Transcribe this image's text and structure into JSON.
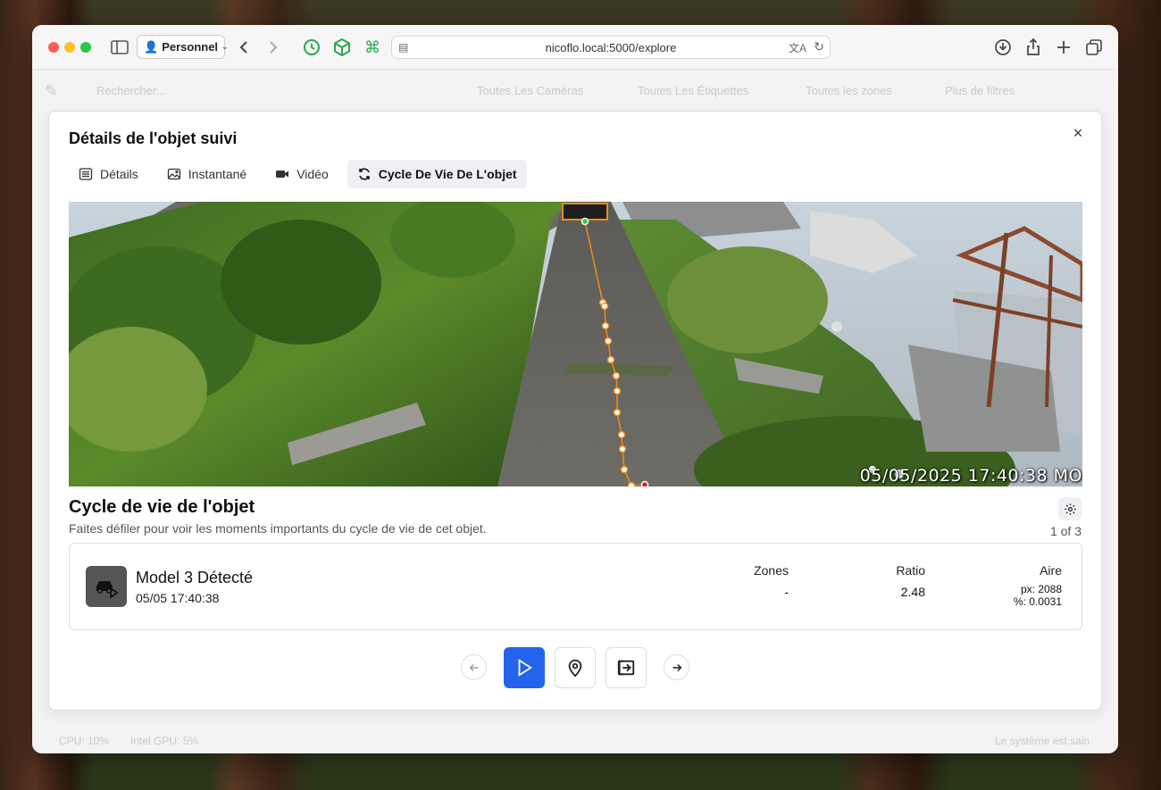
{
  "browser": {
    "profile": "Personnel",
    "url": "nicoflo.local:5000/explore"
  },
  "background_toolbar": {
    "search_placeholder": "Rechercher...",
    "cameras": "Toutes Les Caméras",
    "labels": "Toutes Les Étiquettes",
    "zones": "Toutes les zones",
    "more_filters": "Plus de filtres",
    "footer_left": "CPU: 10%",
    "footer_mid": "Intel GPU: 5%",
    "footer_right": "Le système est sain"
  },
  "modal": {
    "title": "Détails de l'objet suivi",
    "close": "×",
    "tabs": [
      {
        "label": "Détails",
        "icon": "list-icon"
      },
      {
        "label": "Instantané",
        "icon": "image-icon"
      },
      {
        "label": "Vidéo",
        "icon": "video-icon"
      },
      {
        "label": "Cycle De Vie De L'objet",
        "icon": "refresh-icon",
        "active": true
      }
    ],
    "timestamp": "05/05/2025 17:40:38 MO",
    "lifecycle": {
      "title": "Cycle de vie de l'objet",
      "subtitle": "Faites défiler pour voir les moments importants du cycle de vie de cet objet.",
      "count": "1 of 3",
      "event": {
        "title": "Model 3 Détecté",
        "time": "05/05 17:40:38",
        "icon": "car-icon"
      },
      "zones": {
        "label": "Zones",
        "value": "-"
      },
      "ratio": {
        "label": "Ratio",
        "value": "2.48"
      },
      "area": {
        "label": "Aire",
        "px": "px: 2088",
        "pct": "%: 0.0031"
      }
    }
  },
  "colors": {
    "accent": "#2463eb",
    "path": "#f08c1a",
    "start": "#2ecc40",
    "end": "#e02020"
  }
}
